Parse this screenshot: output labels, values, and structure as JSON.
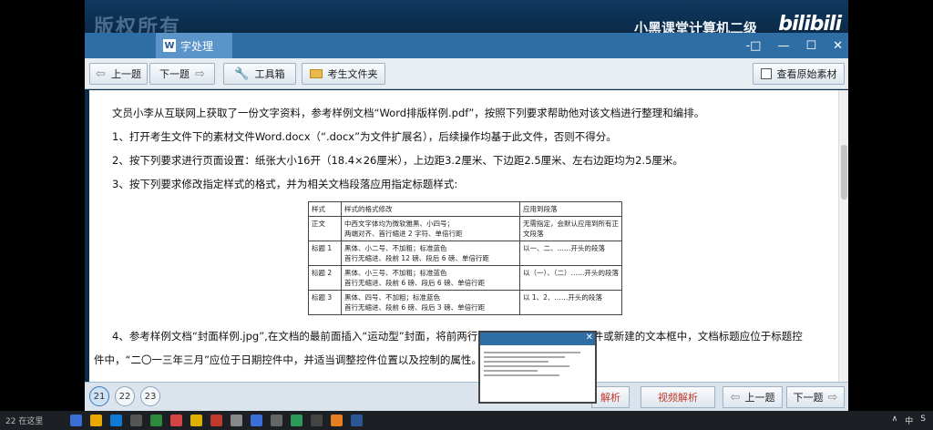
{
  "overlay": {
    "watermark": "版权所有",
    "channel": "小黑课堂计算机二级",
    "logo": "bilibili"
  },
  "window": {
    "tab_label": "字处理",
    "tab_icon": "W",
    "controls": [
      "-□",
      "—",
      "☐",
      "✕"
    ]
  },
  "toolbar": {
    "prev": "上一题",
    "next": "下一题",
    "tools": "工具箱",
    "folder": "考生文件夹",
    "view_original": "查看原始素材"
  },
  "document": {
    "p0": "文员小李从互联网上获取了一份文字资料，参考样例文档“Word排版样例.pdf”，按照下列要求帮助他对该文档进行整理和编排。",
    "p1": "1、打开考生文件下的素材文件Word.docx（“.docx”为文件扩展名），后续操作均基于此文件，否则不得分。",
    "p2": "2、按下列要求进行页面设置：纸张大小16开（18.4×26厘米），上边距3.2厘米、下边距2.5厘米、左右边距均为2.5厘米。",
    "p3": "3、按下列要求修改指定样式的格式，并为相关文档段落应用指定标题样式:",
    "p4": "4、参考样例文档“封面样例.jpg”,在文档的最前面插入“运动型”封面，将前两行文字分别移动到相应的控件或新建的文本框中，文档标题应位于标题控",
    "p5": "件中，“二〇一三年三月”应位于日期控件中，并适当调整控件位置以及控制的属性。"
  },
  "style_table": {
    "header": [
      "样式",
      "样式的格式修改",
      "应用到段落"
    ],
    "rows": [
      [
        "正文",
        "中西文字体均为微软雅黑、小四号；\n两端对齐、首行缩进 2 字符、单倍行距",
        "无需指定，会默认应用到所有正文段落"
      ],
      [
        "标题 1",
        "黑体、小二号、不加粗；标准蓝色\n首行无缩进、段前 12 磅、段后 6 磅、单倍行距",
        "以一、二、……开头的段落"
      ],
      [
        "标题 2",
        "黑体、小三号、不加粗；标准蓝色\n首行无缩进、段前 6 磅、段后 6 磅、单倍行距",
        "以（一）、（二）……开头的段落"
      ],
      [
        "标题 3",
        "黑体、四号、不加粗；标准蓝色\n首行无缩进、段前 6 磅、段后 3 磅、单倍行距",
        "以 1、2、……开头的段落"
      ]
    ]
  },
  "bottom": {
    "pages": [
      "21",
      "22",
      "23"
    ],
    "analysis": "解析",
    "video_analysis": "视频解析",
    "prev": "上一题",
    "next": "下一题"
  },
  "taskbar": {
    "search_text": "22 在这里",
    "tray": [
      "∧",
      "中",
      "S"
    ]
  }
}
